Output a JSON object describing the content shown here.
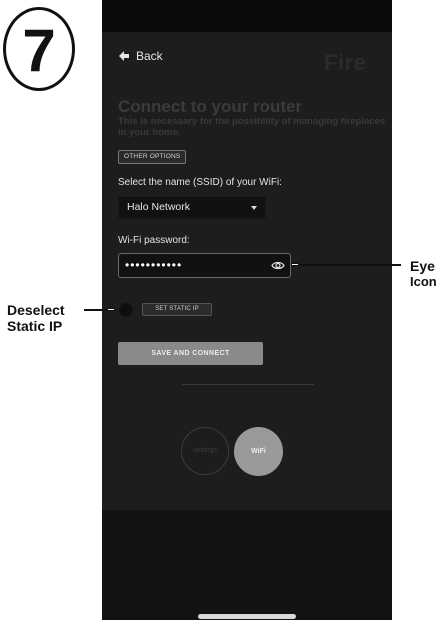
{
  "step": {
    "number": "7"
  },
  "nav": {
    "back_label": "Back",
    "brand": "Fire"
  },
  "header": {
    "title": "Connect to your router",
    "subtitle": "This is necessary for the possibility of managing fireplaces in your home."
  },
  "buttons": {
    "other_options": "OTHER OPTIONS",
    "set_static_ip": "SET STATIC IP",
    "save_and_connect": "SAVE AND CONNECT"
  },
  "form": {
    "ssid_label": "Select the name (SSID) of your WiFi:",
    "ssid_value": "Halo Network",
    "password_label": "Wi-Fi password:",
    "password_value": "•••••••••••",
    "static_ip_checked": false
  },
  "bottom_nav": {
    "settings_label": "settings",
    "wifi_label": "WiFi",
    "active": "WiFi"
  },
  "annotations": {
    "eye_line1": "Eye",
    "eye_line2": "Icon",
    "static_line1": "Deselect",
    "static_line2": "Static IP"
  },
  "icons": {
    "back": "back-arrow-icon",
    "eye": "eye-icon",
    "dropdown": "chevron-down-icon"
  },
  "colors": {
    "screen_bg": "#1d1d1d",
    "field_bg": "#111111",
    "button_disabled": "#8a8a8a",
    "active_tab": "#9a9a9a"
  }
}
